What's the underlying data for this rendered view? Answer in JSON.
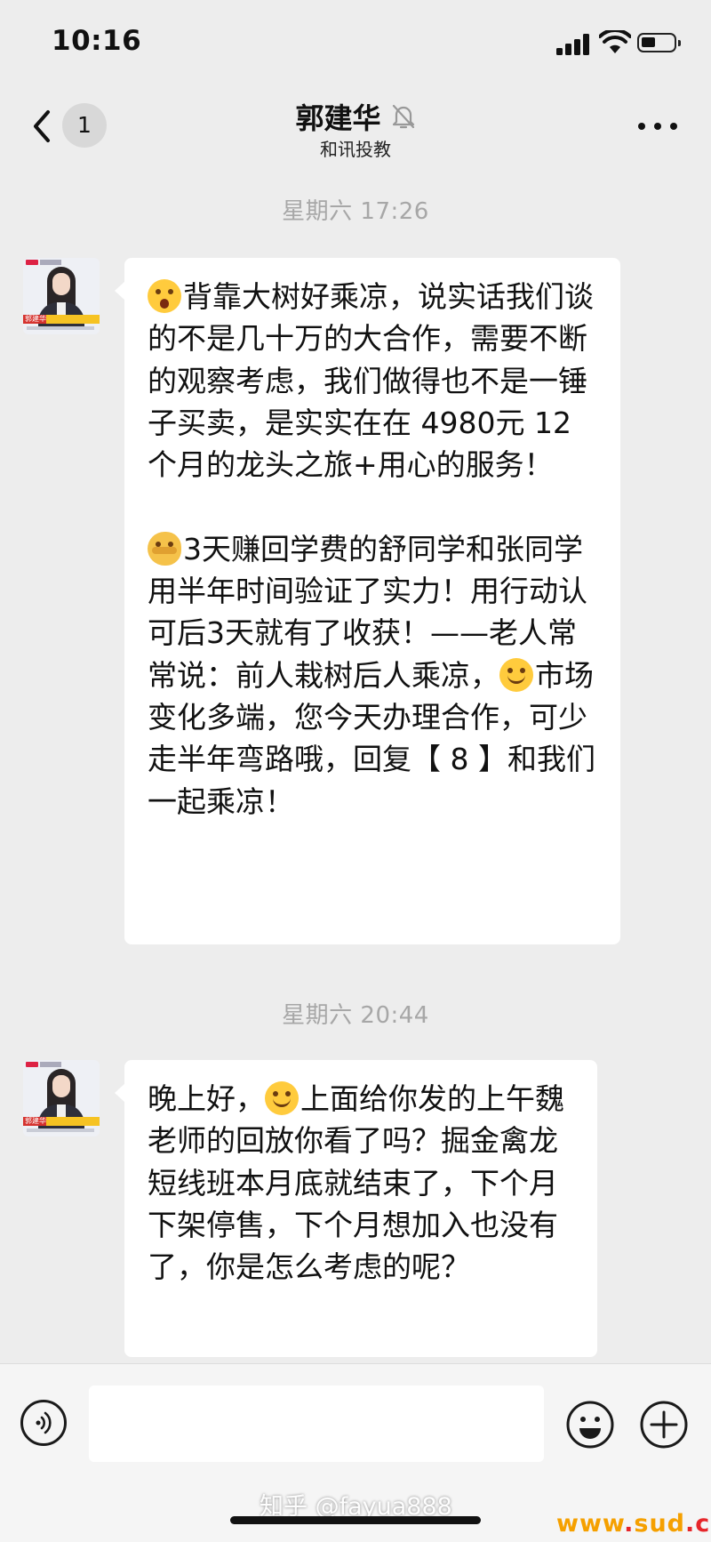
{
  "status_bar": {
    "time": "10:16"
  },
  "header": {
    "back_count": "1",
    "name": "郭建华",
    "subtitle": "和讯投教"
  },
  "messages": [
    {
      "timestamp": "星期六 17:26",
      "avatar_label": "郭建华",
      "paragraphs": [
        {
          "emoji": "astonished-face",
          "text": "背靠大树好乘凉，说实话我们谈的不是几十万的大合作，需要不断的观察考虑，我们做得也不是一锤子买卖，是实实在在 4980元 12个月的龙头之旅+用心的服务！"
        },
        {
          "emoji": "hand-covering-face",
          "text_before": "3天赚回学费的舒同学和张同学用半年时间验证了实力！用行动认可后3天就有了收获！——老人常常说：前人栽树后人乘凉，",
          "emoji2": "smiling-face",
          "text_after": "市场变化多端，您今天办理合作，可少走半年弯路哦，回复【 8 】和我们一起乘凉！"
        }
      ]
    },
    {
      "timestamp": "星期六 20:44",
      "avatar_label": "郭建华",
      "text_before": "晚上好，",
      "emoji": "smiling-face",
      "text_after": "上面给你发的上午魏老师的回放你看了吗？掘金禽龙短线班本月底就结束了，下个月下架停售，下个月想加入也没有了，你是怎么考虑的呢？"
    }
  ],
  "input_bar": {
    "placeholder": ""
  },
  "overlay": {
    "watermark": "知乎 @fayua888",
    "site_a": "www",
    "site_b": "sud",
    "site_c": "cn"
  },
  "colors": {
    "background": "#ededed",
    "bubble": "#ffffff",
    "timestamp": "#a7a7a7"
  }
}
